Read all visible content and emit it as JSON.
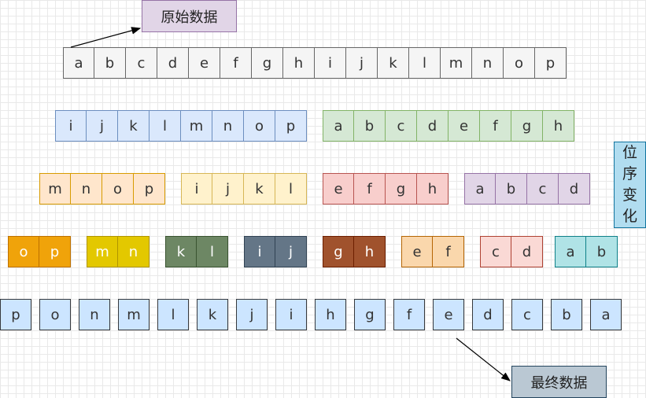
{
  "labels": {
    "original": "原始数据",
    "final": "最终数据",
    "transform": "位\n序\n变\n化"
  },
  "rows": [
    {
      "cells": [
        "a",
        "b",
        "c",
        "d",
        "e",
        "f",
        "g",
        "h",
        "i",
        "j",
        "k",
        "l",
        "m",
        "n",
        "o",
        "p"
      ],
      "fill": "#f5f5f5",
      "stroke": "#666666",
      "text": "#333333"
    },
    {
      "cells": [
        "i",
        "j",
        "k",
        "l",
        "m",
        "n",
        "o",
        "p"
      ],
      "fill": "#dae8fc",
      "stroke": "#6c8ebf",
      "text": "#333333"
    },
    {
      "cells": [
        "a",
        "b",
        "c",
        "d",
        "e",
        "f",
        "g",
        "h"
      ],
      "fill": "#d5e8d4",
      "stroke": "#82b366",
      "text": "#333333"
    },
    {
      "cells": [
        "m",
        "n",
        "o",
        "p"
      ],
      "fill": "#ffe6cc",
      "stroke": "#d79b00",
      "text": "#333333"
    },
    {
      "cells": [
        "i",
        "j",
        "k",
        "l"
      ],
      "fill": "#fff2cc",
      "stroke": "#d6b656",
      "text": "#333333"
    },
    {
      "cells": [
        "e",
        "f",
        "g",
        "h"
      ],
      "fill": "#f8cecc",
      "stroke": "#b85450",
      "text": "#333333"
    },
    {
      "cells": [
        "a",
        "b",
        "c",
        "d"
      ],
      "fill": "#e1d5e7",
      "stroke": "#9673a6",
      "text": "#333333"
    },
    {
      "cells": [
        "o",
        "p"
      ],
      "fill": "#f0a30a",
      "stroke": "#bd7000",
      "text": "#ffffff"
    },
    {
      "cells": [
        "m",
        "n"
      ],
      "fill": "#e3c800",
      "stroke": "#b09500",
      "text": "#ffffff"
    },
    {
      "cells": [
        "k",
        "l"
      ],
      "fill": "#6d8764",
      "stroke": "#3a5431",
      "text": "#ffffff"
    },
    {
      "cells": [
        "i",
        "j"
      ],
      "fill": "#647687",
      "stroke": "#314354",
      "text": "#ffffff"
    },
    {
      "cells": [
        "g",
        "h"
      ],
      "fill": "#a0522d",
      "stroke": "#6d1f00",
      "text": "#ffffff"
    },
    {
      "cells": [
        "e",
        "f"
      ],
      "fill": "#fad7ac",
      "stroke": "#b46504",
      "text": "#333333"
    },
    {
      "cells": [
        "c",
        "d"
      ],
      "fill": "#fad9d5",
      "stroke": "#ae4132",
      "text": "#333333"
    },
    {
      "cells": [
        "a",
        "b"
      ],
      "fill": "#b0e3e6",
      "stroke": "#0e8088",
      "text": "#333333"
    },
    {
      "cells": [
        "p",
        "o",
        "n",
        "m",
        "l",
        "k",
        "j",
        "i",
        "h",
        "g",
        "f",
        "e",
        "d",
        "c",
        "b",
        "a"
      ],
      "fill": "#cce5ff",
      "stroke": "#36393d",
      "text": "#333333"
    }
  ],
  "label_styles": {
    "original": {
      "fill": "#e1d5e7",
      "stroke": "#9673a6"
    },
    "final": {
      "fill": "#bac8d3",
      "stroke": "#23445d"
    },
    "transform": {
      "fill": "#b1ddf0",
      "stroke": "#10739e"
    }
  }
}
